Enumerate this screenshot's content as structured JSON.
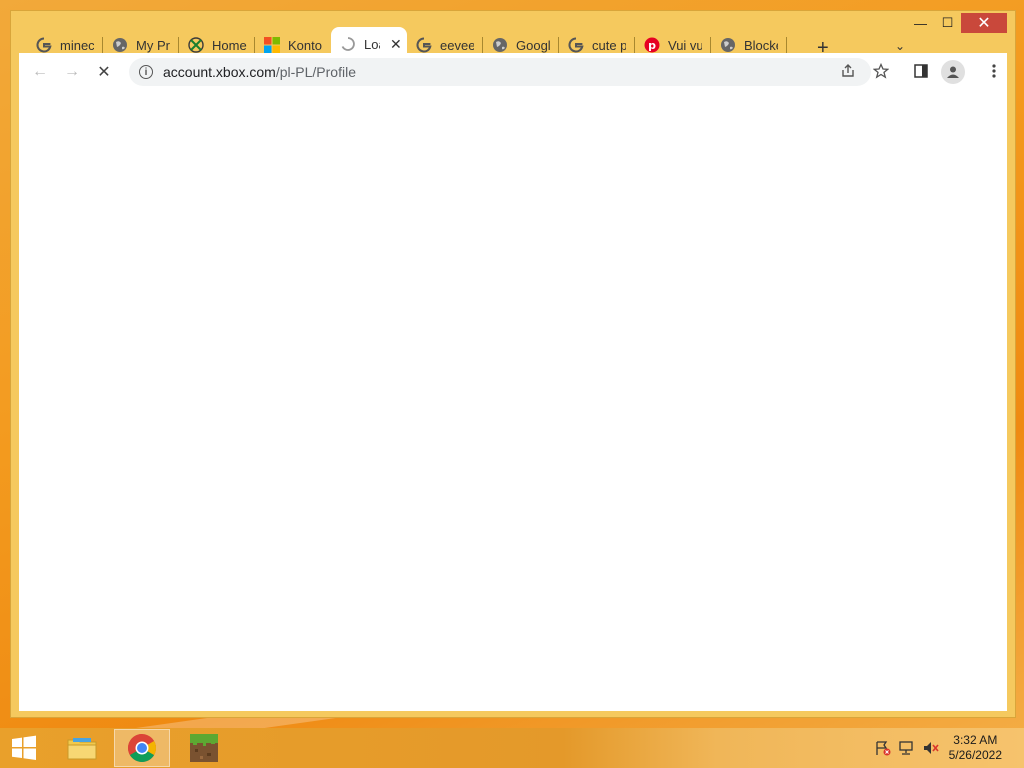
{
  "window": {
    "controls": {
      "minimize": "—",
      "maximize": "☐",
      "close": "✕"
    }
  },
  "tabs": [
    {
      "title": "minecraft",
      "favicon": "google-icon"
    },
    {
      "title": "My Profile",
      "favicon": "globe-icon"
    },
    {
      "title": "Home",
      "favicon": "xbox-icon"
    },
    {
      "title": "Konto",
      "favicon": "microsoft-icon"
    },
    {
      "title": "Loading",
      "favicon": "spinner-icon",
      "active": true
    },
    {
      "title": "eevee",
      "favicon": "google-icon"
    },
    {
      "title": "Google",
      "favicon": "globe-icon"
    },
    {
      "title": "cute pi",
      "favicon": "google-icon"
    },
    {
      "title": "Vui vui",
      "favicon": "pinterest-icon"
    },
    {
      "title": "Blocked",
      "favicon": "globe-icon"
    }
  ],
  "new_tab_label": "+",
  "tab_search_label": "⌄",
  "toolbar": {
    "back": "←",
    "forward": "→",
    "stop": "✕",
    "url_host": "account.xbox.com",
    "url_path": "/pl-PL/Profile"
  },
  "taskbar": {
    "items": [
      {
        "name": "file-explorer",
        "icon": "folder-icon"
      },
      {
        "name": "chrome",
        "icon": "chrome-icon",
        "active": true
      },
      {
        "name": "minecraft",
        "icon": "minecraft-icon"
      }
    ]
  },
  "clock": {
    "time": "3:32 AM",
    "date": "5/26/2022"
  },
  "colors": {
    "desktop": "#f39a1e",
    "window_frame": "#f5c95e",
    "close_button": "#c9483b"
  }
}
